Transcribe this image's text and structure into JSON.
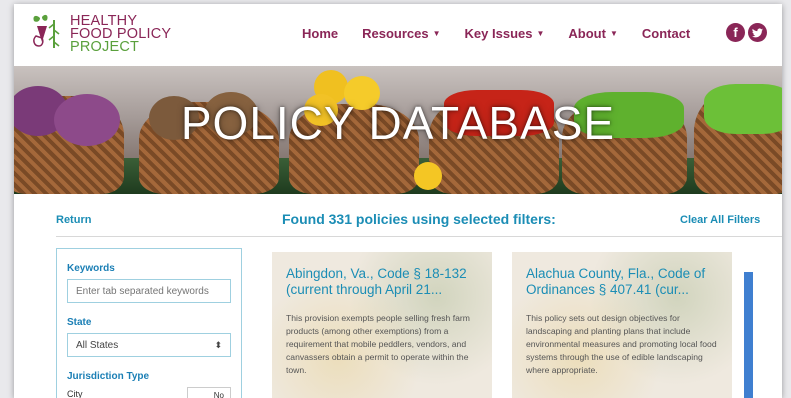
{
  "brand": {
    "line1": "HEALTHY",
    "line2": "FOOD POLICY",
    "line3": "PROJECT",
    "color": "#8a2657"
  },
  "nav": {
    "home": "Home",
    "resources": "Resources",
    "key_issues": "Key Issues",
    "about": "About",
    "contact": "Contact",
    "caret": "▼"
  },
  "social": {
    "facebook_icon": "f",
    "twitter_icon": "t"
  },
  "hero": {
    "title": "POLICY DATABASE"
  },
  "results": {
    "return_label": "Return",
    "found_text": "Found 331 policies using selected filters:",
    "clear_label": "Clear All Filters",
    "accent": "#1b8db5"
  },
  "filters": {
    "keywords_label": "Keywords",
    "keywords_placeholder": "Enter tab separated keywords",
    "state_label": "State",
    "state_value": "All States",
    "state_caret": "⬍",
    "jurisdiction_label": "Jurisdiction Type",
    "city_label": "City",
    "city_toggle": "No"
  },
  "cards": [
    {
      "title": "Abingdon, Va., Code § 18-132 (current through April 21...",
      "description": "This provision exempts people selling fresh farm products (among other exemptions) from a requirement that mobile peddlers, vendors, and canvassers obtain a permit to operate within the town."
    },
    {
      "title": "Alachua County, Fla., Code of Ordinances § 407.41 (cur...",
      "description": "This policy sets out design objectives for landscaping and planting plans that include environmental measures and promoting local food systems through the use of edible landscaping where appropriate."
    }
  ]
}
